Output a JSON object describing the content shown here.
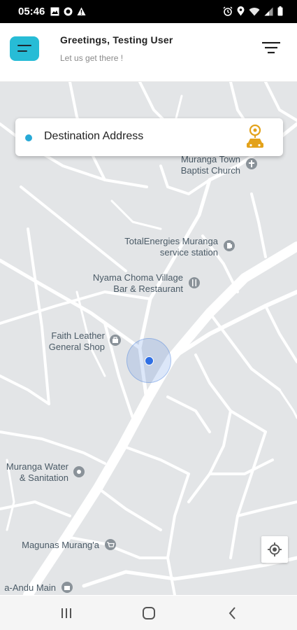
{
  "status_bar": {
    "time": "05:46",
    "left_icons": [
      "image-icon",
      "app-icon",
      "warning-icon"
    ],
    "right_icons": [
      "alarm-icon",
      "location-icon",
      "wifi-icon",
      "signal-icon",
      "battery-icon"
    ]
  },
  "header": {
    "greeting": "Greetings, Testing User",
    "subtitle": "Let us get there !",
    "accent_color": "#27bcd6"
  },
  "destination": {
    "placeholder": "Destination Address",
    "icon": "taxi-pin-icon"
  },
  "map": {
    "pois": [
      {
        "label_1": "Muranga Town",
        "label_2": "Baptist Church",
        "icon": "church-pin-icon"
      },
      {
        "label_1": "TotalEnergies Muranga",
        "label_2": "service station",
        "icon": "gas-station-pin-icon"
      },
      {
        "label_1": "Nyama Choma Village",
        "label_2": "Bar & Restaurant",
        "icon": "restaurant-pin-icon"
      },
      {
        "label_1": "Faith Leather",
        "label_2": "General Shop",
        "icon": "shop-pin-icon"
      },
      {
        "label_1": "Muranga Water",
        "label_2": "& Sanitation",
        "icon": "utility-pin-icon"
      },
      {
        "label_1": "Magunas Murang'a",
        "icon": "shopping-cart-pin-icon"
      },
      {
        "label_1": "a-Andu Main",
        "icon": "store-pin-icon"
      }
    ]
  },
  "navbar": {
    "buttons": [
      "recents-icon",
      "home-icon",
      "back-icon"
    ]
  }
}
